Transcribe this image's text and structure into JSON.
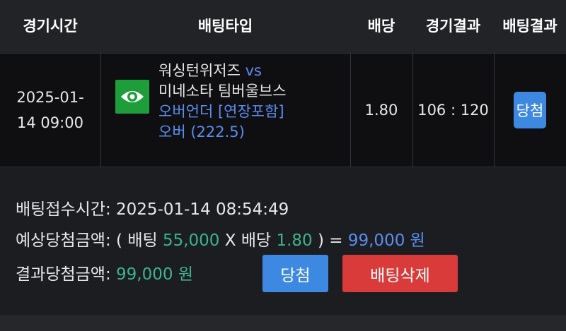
{
  "header": {
    "col_time": "경기시간",
    "col_bettype": "배팅타입",
    "col_odds": "배당",
    "col_result": "경기결과",
    "col_betresult": "배팅결과"
  },
  "row": {
    "date": "2025-01-",
    "time": "14 09:00",
    "team_home": "워싱턴위저즈",
    "vs": "vs",
    "team_away": "미네소타 팀버울브스",
    "bet_type": "오버언더 [연장포함]",
    "pick": "오버 (222.5)",
    "odds": "1.80",
    "score": "106 : 120",
    "bet_result": "당첨"
  },
  "summary": {
    "bet_time_label": "배팅접수시간:",
    "bet_time_value": "2025-01-14 08:54:49",
    "expected_label": "예상당첨금액:",
    "open_paren": "( 배팅",
    "stake": "55,000",
    "x_odds": "X 배당",
    "odds": "1.80",
    "close_eq": ") =",
    "expected_amount": "99,000 원",
    "result_label": "결과당첨금액:",
    "result_amount": "99,000 원",
    "win_button": "당첨",
    "delete_button": "배팅삭제"
  },
  "colors": {
    "accent_blue": "#3d88e0",
    "delete_red": "#d93a3a",
    "amount_green": "#3cb48c",
    "link_blue": "#5b8def",
    "icon_green": "#1e9e3a"
  },
  "icons": {
    "match_icon": "eye-icon"
  }
}
